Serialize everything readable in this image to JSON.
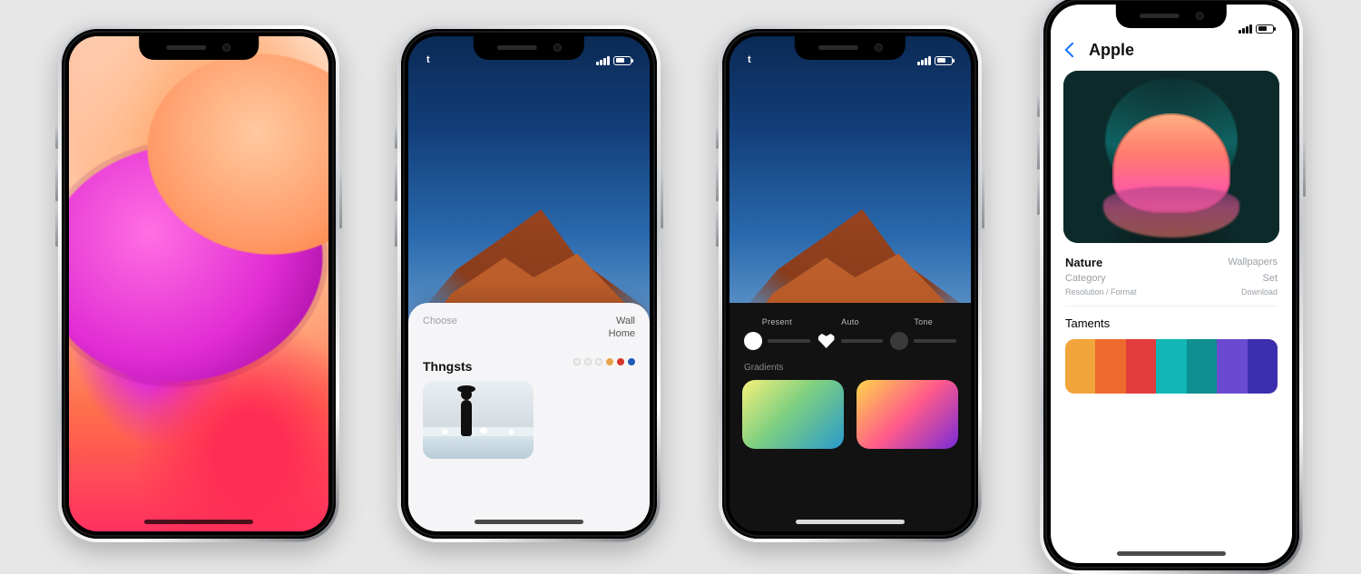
{
  "phones": {
    "p2": {
      "status_time": "t",
      "sheet_label_left": "Choose",
      "sheet_value_right": "Wall",
      "sheet_sub_right": "Home",
      "section_title": "Thngsts"
    },
    "p3": {
      "status_time": "t",
      "sliders": [
        {
          "caption": "Present"
        },
        {
          "caption": "Auto"
        },
        {
          "caption": "Tone"
        }
      ],
      "subheading": "Gradients"
    },
    "p4": {
      "title": "Apple",
      "meta_left_1": "Nature",
      "meta_right_1": "Wallpapers",
      "meta_left_2": "Category",
      "meta_right_2": "Set",
      "meta_left_3": "Resolution / Format",
      "meta_right_3": "Download",
      "section_title": "Taments",
      "palette": [
        "#f2a53a",
        "#ef6a2e",
        "#e23d3d",
        "#12b6b6",
        "#0f8f8f",
        "#6a4bd0",
        "#3b2fae"
      ]
    }
  }
}
